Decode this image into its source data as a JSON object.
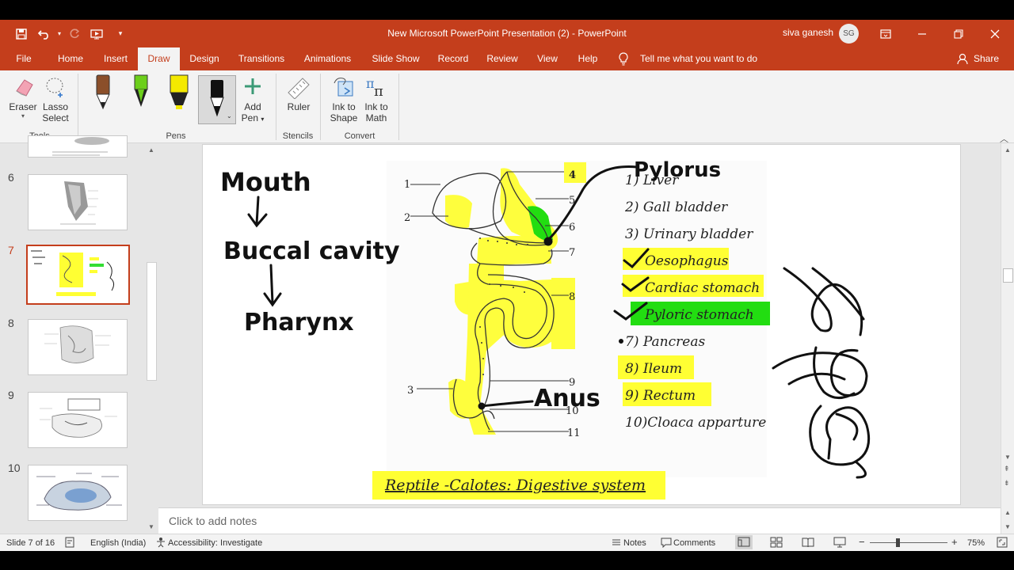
{
  "window": {
    "title": "New Microsoft PowerPoint Presentation (2)  -  PowerPoint",
    "user_name": "siva ganesh",
    "user_initials": "SG"
  },
  "tabs": [
    "File",
    "Home",
    "Insert",
    "Draw",
    "Design",
    "Transitions",
    "Animations",
    "Slide Show",
    "Record",
    "Review",
    "View",
    "Help"
  ],
  "active_tab": "Draw",
  "tell_me": "Tell me what you want to do",
  "share": "Share",
  "ribbon": {
    "eraser": "Eraser",
    "lasso_line1": "Lasso",
    "lasso_line2": "Select",
    "add_pen_line1": "Add",
    "add_pen_line2": "Pen",
    "ruler": "Ruler",
    "ink_shape_line1": "Ink to",
    "ink_shape_line2": "Shape",
    "ink_math_line1": "Ink to",
    "ink_math_line2": "Math",
    "group_tools": "Tools",
    "group_pens": "Pens",
    "group_stencils": "Stencils",
    "group_convert": "Convert",
    "pen_colors": [
      "#e07b00",
      "#6ccf1b",
      "#f4e900",
      "#111111"
    ]
  },
  "thumbnails": [
    {
      "num": "6"
    },
    {
      "num": "7"
    },
    {
      "num": "8"
    },
    {
      "num": "9"
    },
    {
      "num": "10"
    }
  ],
  "selected_slide": "7",
  "slide": {
    "handwritten": {
      "mouth": "Mouth",
      "buccal": "Buccal cavity",
      "pharynx": "Pharynx",
      "pylorus": "Pylorus",
      "anus": "Anus"
    },
    "diagram_numbers": [
      "1",
      "2",
      "3",
      "4",
      "5",
      "6",
      "7",
      "8",
      "9",
      "10",
      "11"
    ],
    "legend": [
      "1) Liver",
      "2) Gall bladder",
      "3) Urinary bladder",
      "4) Oesophagus",
      "5) Cardiac stomach",
      "6) Pyloric stomach",
      "7) Pancreas",
      "8) Ileum",
      "9) Rectum",
      "10)Cloaca apparture"
    ],
    "legend_display": [
      "1) Liver",
      "2) Gall bladder",
      "3) Urinary bladder",
      "Oesophagus",
      "Cardiac stomach",
      "Pyloric stomach",
      "7) Pancreas",
      "8) Ileum",
      "9) Rectum",
      "10)Cloaca apparture"
    ],
    "caption": "Reptile -Calotes: Digestive system",
    "highlight_yellow": "#ffff33",
    "highlight_green": "#22dd11"
  },
  "notes_placeholder": "Click to add notes",
  "status": {
    "slide_info": "Slide 7 of 16",
    "language": "English (India)",
    "accessibility": "Accessibility: Investigate",
    "notes": "Notes",
    "comments": "Comments",
    "zoom_minus": "−",
    "zoom_plus": "+",
    "zoom": "75%"
  }
}
